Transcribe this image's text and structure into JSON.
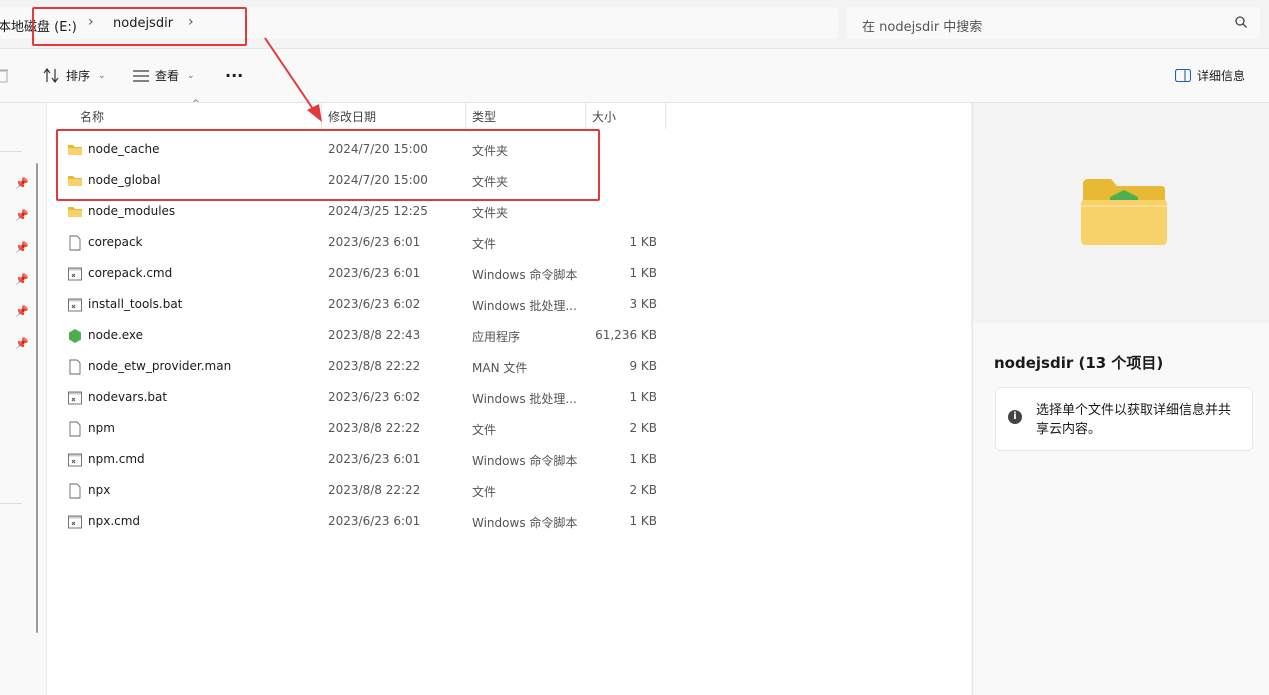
{
  "address": {
    "drive": "本地磁盘 (E:)",
    "folder": "nodejsdir",
    "sep_icon": "chevron-right-icon"
  },
  "search": {
    "placeholder": "在 nodejsdir 中搜索"
  },
  "toolbar": {
    "sort_label": "排序",
    "view_label": "查看",
    "more_label": "···",
    "details_label": "详细信息"
  },
  "columns": {
    "name": "名称",
    "date": "修改日期",
    "type": "类型",
    "size": "大小"
  },
  "files": [
    {
      "name": "node_cache",
      "date": "2024/7/20 15:00",
      "type": "文件夹",
      "size": "",
      "icon": "folder-icon"
    },
    {
      "name": "node_global",
      "date": "2024/7/20 15:00",
      "type": "文件夹",
      "size": "",
      "icon": "folder-icon"
    },
    {
      "name": "node_modules",
      "date": "2024/3/25 12:25",
      "type": "文件夹",
      "size": "",
      "icon": "folder-icon"
    },
    {
      "name": "corepack",
      "date": "2023/6/23 6:01",
      "type": "文件",
      "size": "1 KB",
      "icon": "file-icon"
    },
    {
      "name": "corepack.cmd",
      "date": "2023/6/23 6:01",
      "type": "Windows 命令脚本",
      "size": "1 KB",
      "icon": "script-icon"
    },
    {
      "name": "install_tools.bat",
      "date": "2023/6/23 6:02",
      "type": "Windows 批处理...",
      "size": "3 KB",
      "icon": "script-icon"
    },
    {
      "name": "node.exe",
      "date": "2023/8/8 22:43",
      "type": "应用程序",
      "size": "61,236 KB",
      "icon": "node-exe-icon"
    },
    {
      "name": "node_etw_provider.man",
      "date": "2023/8/8 22:22",
      "type": "MAN 文件",
      "size": "9 KB",
      "icon": "file-icon"
    },
    {
      "name": "nodevars.bat",
      "date": "2023/6/23 6:02",
      "type": "Windows 批处理...",
      "size": "1 KB",
      "icon": "script-icon"
    },
    {
      "name": "npm",
      "date": "2023/8/8 22:22",
      "type": "文件",
      "size": "2 KB",
      "icon": "file-icon"
    },
    {
      "name": "npm.cmd",
      "date": "2023/6/23 6:01",
      "type": "Windows 命令脚本",
      "size": "1 KB",
      "icon": "script-icon"
    },
    {
      "name": "npx",
      "date": "2023/8/8 22:22",
      "type": "文件",
      "size": "2 KB",
      "icon": "file-icon"
    },
    {
      "name": "npx.cmd",
      "date": "2023/6/23 6:01",
      "type": "Windows 命令脚本",
      "size": "1 KB",
      "icon": "script-icon"
    }
  ],
  "details": {
    "title": "nodejsdir (13 个项目)",
    "info": "选择单个文件以获取详细信息并共享云内容。"
  },
  "colors": {
    "annotation": "#e03a3a",
    "folder": "#f2c94c",
    "node": "#4caf50"
  }
}
